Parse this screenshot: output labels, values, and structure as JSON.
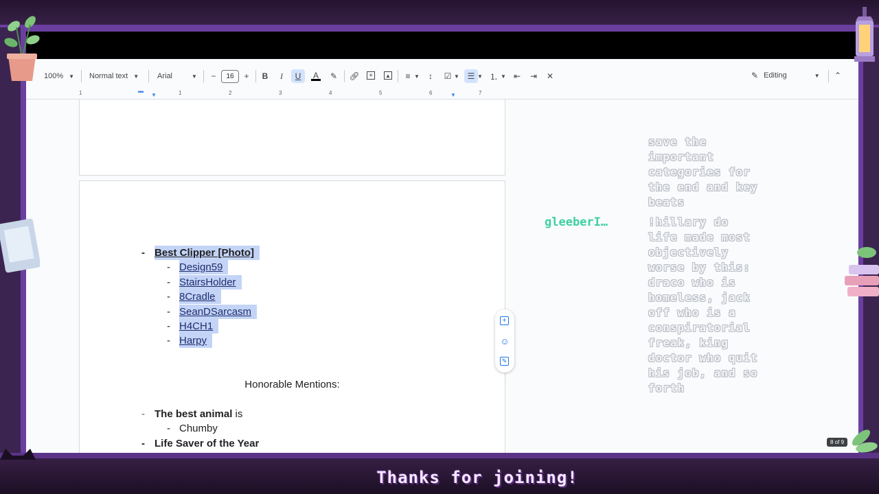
{
  "toolbar": {
    "zoom": "100%",
    "style": "Normal text",
    "font": "Arial",
    "font_size": "16",
    "mode": "Editing"
  },
  "ruler": {
    "numbers": [
      "1",
      "1",
      "2",
      "3",
      "4",
      "5",
      "6",
      "7"
    ]
  },
  "document": {
    "section": {
      "heading": "Best Clipper [Photo]",
      "nominees": [
        "Design59",
        "StairsHolder",
        "8Cradle",
        "SeanDSarcasm",
        "H4CH1",
        "Harpy"
      ]
    },
    "honorable_title": "Honorable Mentions:",
    "animal_label": "The best animal",
    "animal_suffix": " is",
    "animal_value": "Chumby",
    "life_saver": "Life Saver of the Year"
  },
  "chat": {
    "prev_message": "save the\nimportant\ncategories for\nthe end and key\nbeats",
    "username": "gleeberI…",
    "message": "!hillary do\nlife made most\nobjectively\nworse by this:\ndraco who is\nhomeless, jack\noff who is a\nconspiratorial\nfreak, king\ndoctor who quit\nhis job, and so\nforth"
  },
  "page_indicator": "8 of 9",
  "footer": "Thanks for joining!",
  "colors": {
    "frame": "#6a3fa0",
    "selection": "#c4d4f6",
    "username": "#3ed0a0"
  }
}
